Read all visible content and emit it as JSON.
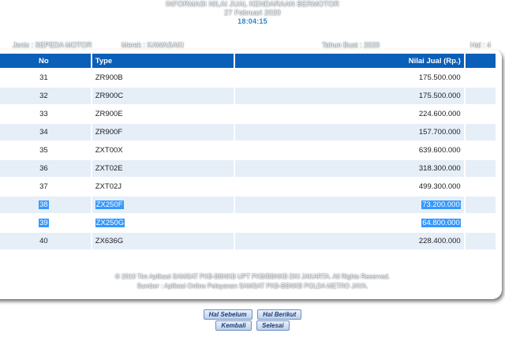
{
  "header": {
    "title": "INFORMASI NILAI JUAL KENDARAAN BERMOTOR",
    "date": "27 Februari 2020",
    "time": "18:04:15"
  },
  "meta": {
    "jenis": "Jenis : SEPEDA MOTOR",
    "merek": "Merek : KAWASAKI",
    "tahun": "Tahun Buat : 2020",
    "page": "Hal : 4"
  },
  "table": {
    "columns": {
      "no": "No",
      "type": "Type",
      "value": "Nilai Jual (Rp.)"
    },
    "rows": [
      {
        "no": "31",
        "type": "ZR900B",
        "value": "175.500.000",
        "selected": false
      },
      {
        "no": "32",
        "type": "ZR900C",
        "value": "175.500.000",
        "selected": false
      },
      {
        "no": "33",
        "type": "ZR900E",
        "value": "224.600.000",
        "selected": false
      },
      {
        "no": "34",
        "type": "ZR900F",
        "value": "157.700.000",
        "selected": false
      },
      {
        "no": "35",
        "type": "ZXT00X",
        "value": "639.600.000",
        "selected": false
      },
      {
        "no": "36",
        "type": "ZXT02E",
        "value": "318.300.000",
        "selected": false
      },
      {
        "no": "37",
        "type": "ZXT02J",
        "value": "499.300.000",
        "selected": false
      },
      {
        "no": "38",
        "type": "ZX250F",
        "value": "73.200.000",
        "selected": true
      },
      {
        "no": "39",
        "type": "ZX250G",
        "value": "64.800.000",
        "selected": true
      },
      {
        "no": "40",
        "type": "ZX636G",
        "value": "228.400.000",
        "selected": false
      }
    ]
  },
  "footer": {
    "line1": "© 2010 Tim Aplikasi SAMSAT PKB-BBNKB UPT PKB/BBNKB DKI JAKARTA. All Rights Reserved.",
    "line2": "Sumber : Aplikasi Online Pelayanan SAMSAT PKB-BBNKB POLDA METRO JAYA."
  },
  "buttons": {
    "prev": "Hal Sebelum",
    "next": "Hal Berikut",
    "back": "Kembali",
    "done": "Selesai"
  },
  "colors": {
    "header_blue": "#0a5fb8",
    "row_stripe": "#e6eef8",
    "selection": "#3399ff"
  }
}
